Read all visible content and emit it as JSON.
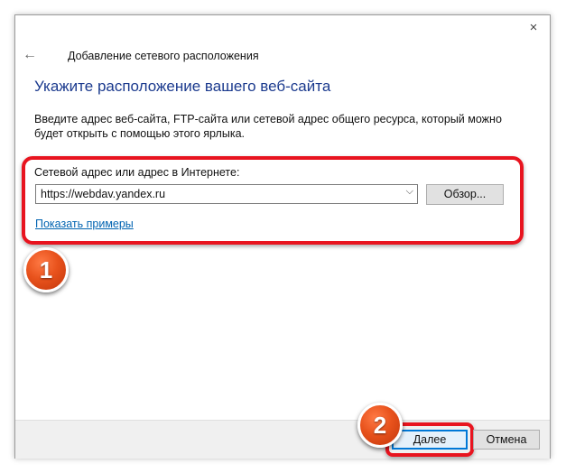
{
  "window": {
    "title": "Добавление сетевого расположения",
    "close_icon": "×",
    "back_icon": "←"
  },
  "main": {
    "heading": "Укажите расположение вашего веб-сайта",
    "description": "Введите адрес веб-сайта, FTP-сайта или сетевой адрес общего ресурса, который можно будет открыть с помощью этого ярлыка.",
    "field_label": "Сетевой адрес или адрес в Интернете:",
    "address_value": "https://webdav.yandex.ru",
    "chevron_icon": "⌵",
    "browse_label": "Обзор...",
    "examples_link": "Показать примеры"
  },
  "footer": {
    "next_label": "Далее",
    "cancel_label": "Отмена"
  },
  "annotations": {
    "badge_1": "1",
    "badge_2": "2",
    "highlight_color": "#e8141f",
    "badge_color": "#e8521c"
  }
}
